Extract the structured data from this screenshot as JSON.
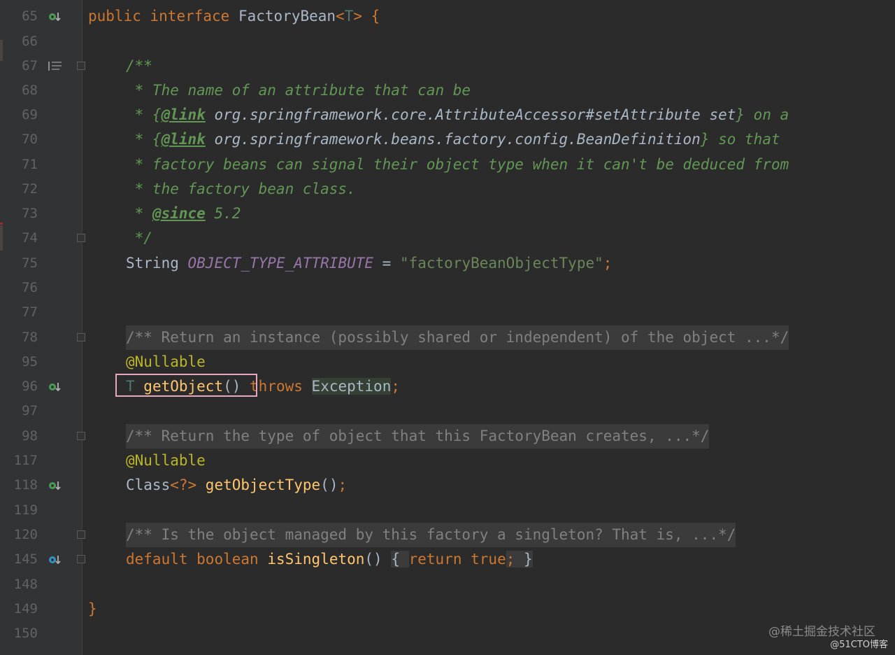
{
  "colors": {
    "background": "#2b2b2b",
    "gutter": "#313335",
    "keyword": "#cc7832",
    "doc_comment": "#629755",
    "method": "#ffc66d",
    "annotation": "#bbb529",
    "string": "#6a8759",
    "constant": "#9876aa",
    "highlight_border": "#e8a7c0"
  },
  "editor": {
    "line_numbers": [
      "65",
      "66",
      "67",
      "68",
      "69",
      "70",
      "71",
      "72",
      "73",
      "74",
      "75",
      "76",
      "77",
      "78",
      "95",
      "96",
      "97",
      "98",
      "117",
      "118",
      "119",
      "120",
      "145",
      "148",
      "149",
      "150"
    ],
    "gutter_icons": {
      "implemented_marker": "implemented-method-icon",
      "doc_toggle": "render-doc-icon",
      "override_marker": "override-method-icon"
    },
    "code": {
      "l65_public": "public",
      "l65_interface": "interface",
      "l65_name": "FactoryBean",
      "l65_lt": "<",
      "l65_T": "T",
      "l65_rest": "> {",
      "l67": "/**",
      "l68": " * The name of an attribute that can be",
      "l69_star": " * {",
      "l69_tag": "@link",
      "l69_ref": " org.springframework.core.AttributeAccessor#setAttribute set",
      "l69_end": "} on a",
      "l70_star": " * {",
      "l70_tag": "@link",
      "l70_ref": " org.springframework.beans.factory.config.BeanDefinition",
      "l70_end": "} so that",
      "l71": " * factory beans can signal their object type when it can't be deduced from",
      "l72": " * the factory bean class.",
      "l73_star": " * ",
      "l73_tag": "@since",
      "l73_ver": " 5.2",
      "l74": " */",
      "l75_type": "String ",
      "l75_const": "OBJECT_TYPE_ATTRIBUTE",
      "l75_eq": " = ",
      "l75_str": "\"factoryBeanObjectType\"",
      "l75_semi": ";",
      "l78": "/** Return an instance (possibly shared or independent) of the object ...*/",
      "l95": "@Nullable",
      "l96_T": "T ",
      "l96_method": "getObject",
      "l96_parens": "()",
      "l96_throws": " throws ",
      "l96_exc": "Exception",
      "l96_semi": ";",
      "l98": "/** Return the type of object that this FactoryBean creates, ...*/",
      "l117": "@Nullable",
      "l118_class": "Class",
      "l118_gen": "<?> ",
      "l118_method": "getObjectType",
      "l118_rest": "()",
      "l118_semi": ";",
      "l120": "/** Is the object managed by this factory a singleton? That is, ...*/",
      "l145_default": "default ",
      "l145_boolean": "boolean ",
      "l145_method": "isSingleton",
      "l145_parens": "() ",
      "l145_ob": "{ ",
      "l145_return": "return ",
      "l145_true": "true",
      "l145_semi": "; ",
      "l145_cb": "}",
      "l149": "}"
    }
  },
  "watermark": {
    "line1": "@稀土掘金技术社区",
    "line2": "@51CTO博客"
  }
}
